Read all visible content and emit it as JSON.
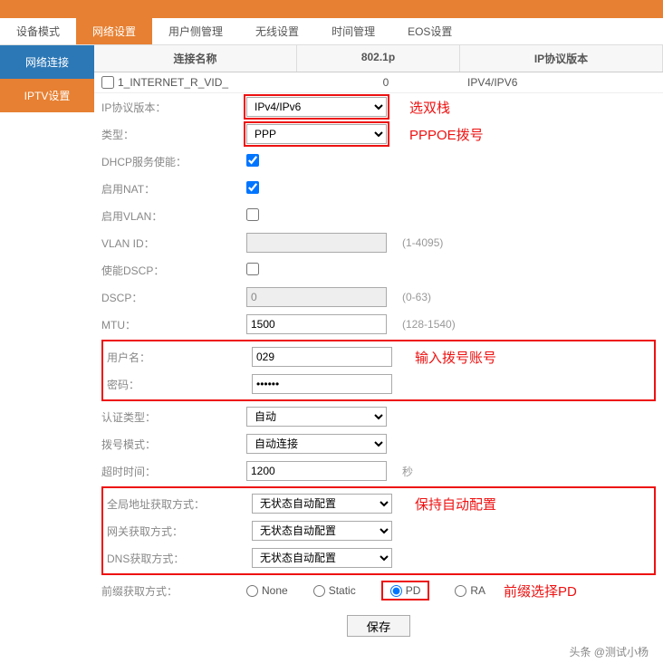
{
  "nav": {
    "tabs": [
      "设备模式",
      "网络设置",
      "用户侧管理",
      "无线设置",
      "时间管理",
      "EOS设置"
    ],
    "active_index": 1
  },
  "sidebar": {
    "items": [
      "网络连接",
      "IPTV设置"
    ],
    "active_index": 1
  },
  "table": {
    "headers": {
      "name": "连接名称",
      "dot1p": "802.1p",
      "ipver": "IP协议版本"
    },
    "row": {
      "name": "1_INTERNET_R_VID_",
      "dot1p": "0",
      "ipver": "IPV4/IPV6"
    }
  },
  "fields": {
    "ipver": {
      "label": "IP协议版本：",
      "value": "IPv4/IPv6"
    },
    "type": {
      "label": "类型：",
      "value": "PPP"
    },
    "dhcp": {
      "label": "DHCP服务使能："
    },
    "nat": {
      "label": "启用NAT："
    },
    "vlan": {
      "label": "启用VLAN："
    },
    "vlanid": {
      "label": "VLAN ID：",
      "hint": "(1-4095)"
    },
    "dscp_en": {
      "label": "使能DSCP："
    },
    "dscp": {
      "label": "DSCP：",
      "value": "0",
      "hint": "(0-63)"
    },
    "mtu": {
      "label": "MTU：",
      "value": "1500",
      "hint": "(128-1540)"
    },
    "user": {
      "label": "用户名：",
      "value": "029"
    },
    "pass": {
      "label": "密码：",
      "value": "••••••"
    },
    "auth": {
      "label": "认证类型：",
      "value": "自动"
    },
    "dial": {
      "label": "拨号模式：",
      "value": "自动连接"
    },
    "timeout": {
      "label": "超时时间：",
      "value": "1200",
      "hint": "秒"
    },
    "global_addr": {
      "label": "全局地址获取方式：",
      "value": "无状态自动配置"
    },
    "gateway": {
      "label": "网关获取方式：",
      "value": "无状态自动配置"
    },
    "dns": {
      "label": "DNS获取方式：",
      "value": "无状态自动配置"
    },
    "prefix": {
      "label": "前缀获取方式：",
      "options": [
        "None",
        "Static",
        "PD",
        "RA"
      ],
      "selected": "PD"
    },
    "save": "保存"
  },
  "annotations": {
    "ipver": "选双栈",
    "type": "PPPOE拨号",
    "creds": "输入拨号账号",
    "addr": "保持自动配置",
    "prefix": "前缀选择PD"
  },
  "footer": "头条 @测试小杨"
}
